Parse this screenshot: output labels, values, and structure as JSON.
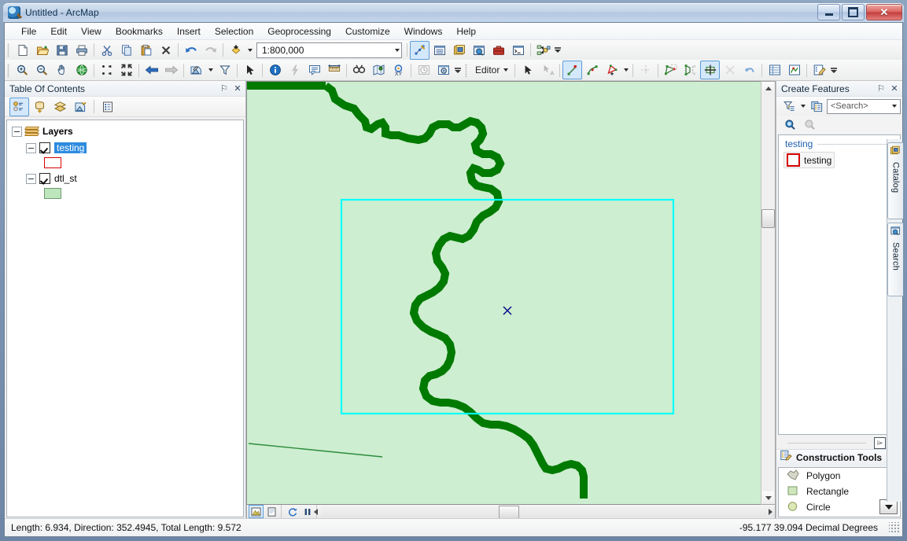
{
  "window": {
    "title": "Untitled - ArcMap",
    "app_icon": "arcmap-globe-icon",
    "minimize_label": "Minimize",
    "maximize_label": "Maximize",
    "close_label": "Close"
  },
  "menubar": {
    "items": [
      {
        "label": "File"
      },
      {
        "label": "Edit"
      },
      {
        "label": "View"
      },
      {
        "label": "Bookmarks"
      },
      {
        "label": "Insert"
      },
      {
        "label": "Selection"
      },
      {
        "label": "Geoprocessing"
      },
      {
        "label": "Customize"
      },
      {
        "label": "Windows"
      },
      {
        "label": "Help"
      }
    ]
  },
  "standard_toolbar": {
    "scale_value": "1:800,000",
    "buttons": [
      {
        "name": "new-map-icon",
        "title": "New Map File"
      },
      {
        "name": "open-icon",
        "title": "Open"
      },
      {
        "name": "save-icon",
        "title": "Save"
      },
      {
        "name": "print-icon",
        "title": "Print"
      },
      {
        "name": "cut-icon",
        "title": "Cut"
      },
      {
        "name": "copy-icon",
        "title": "Copy"
      },
      {
        "name": "paste-icon",
        "title": "Paste"
      },
      {
        "name": "delete-icon",
        "title": "Delete"
      },
      {
        "name": "undo-icon",
        "title": "Undo"
      },
      {
        "name": "redo-icon",
        "title": "Redo"
      },
      {
        "name": "add-data-icon",
        "title": "Add Data"
      },
      {
        "name": "editor-vertices-icon",
        "title": "Editor Toolbar"
      },
      {
        "name": "table-of-contents-icon",
        "title": "Table Of Contents"
      },
      {
        "name": "catalog-window-icon",
        "title": "Catalog"
      },
      {
        "name": "search-window-icon",
        "title": "Search"
      },
      {
        "name": "toolbox-icon",
        "title": "ArcToolbox"
      },
      {
        "name": "python-window-icon",
        "title": "Python Window"
      },
      {
        "name": "model-builder-icon",
        "title": "ModelBuilder"
      }
    ]
  },
  "tools_toolbar": {
    "editor_label": "Editor",
    "buttons": [
      {
        "name": "zoom-in-icon",
        "title": "Zoom In"
      },
      {
        "name": "zoom-out-icon",
        "title": "Zoom Out"
      },
      {
        "name": "pan-icon",
        "title": "Pan"
      },
      {
        "name": "full-extent-icon",
        "title": "Full Extent"
      },
      {
        "name": "fixed-zoom-in-icon",
        "title": "Fixed Zoom In"
      },
      {
        "name": "fixed-zoom-out-icon",
        "title": "Fixed Zoom Out"
      },
      {
        "name": "go-back-extent-icon",
        "title": "Go Back To Previous Extent"
      },
      {
        "name": "go-next-extent-icon",
        "title": "Go To Next Extent"
      },
      {
        "name": "select-features-icon",
        "title": "Select Features"
      },
      {
        "name": "clear-selection-icon",
        "title": "Clear Selected Features"
      },
      {
        "name": "select-elements-icon",
        "title": "Select Elements"
      },
      {
        "name": "identify-icon",
        "title": "Identify"
      },
      {
        "name": "hyperlink-icon",
        "title": "Hyperlink"
      },
      {
        "name": "html-popup-icon",
        "title": "HTML Popup"
      },
      {
        "name": "measure-icon",
        "title": "Measure"
      },
      {
        "name": "find-icon",
        "title": "Find"
      },
      {
        "name": "find-route-icon",
        "title": "Find Route"
      },
      {
        "name": "go-to-xy-icon",
        "title": "Go To XY"
      },
      {
        "name": "time-slider-icon",
        "title": "Time Slider"
      },
      {
        "name": "create-viewer-icon",
        "title": "Create Viewer Window"
      },
      {
        "name": "edit-tool-icon",
        "title": "Edit Tool"
      },
      {
        "name": "edit-annotation-icon",
        "title": "Edit Annotation Tool"
      },
      {
        "name": "straight-segment-icon",
        "title": "Straight Segment"
      },
      {
        "name": "trace-icon",
        "title": "Trace"
      },
      {
        "name": "construct-point-icon",
        "title": "Construct Points"
      },
      {
        "name": "edit-vertices-icon",
        "title": "Edit Vertices"
      },
      {
        "name": "reshape-feature-icon",
        "title": "Reshape Feature Tool"
      },
      {
        "name": "cut-polygons-icon",
        "title": "Cut Polygons Tool"
      },
      {
        "name": "split-tool-icon",
        "title": "Split Tool"
      },
      {
        "name": "rotate-tool-icon",
        "title": "Rotate Tool"
      },
      {
        "name": "attributes-icon",
        "title": "Attributes"
      },
      {
        "name": "sketch-properties-icon",
        "title": "Sketch Properties"
      },
      {
        "name": "create-features-icon",
        "title": "Create Features"
      }
    ]
  },
  "table_of_contents": {
    "caption": "Table Of Contents",
    "pin_glyph": "⚐",
    "close_glyph": "✕",
    "toolbar": [
      {
        "name": "list-by-drawing-order-icon",
        "title": "List By Drawing Order",
        "active": true
      },
      {
        "name": "list-by-source-icon",
        "title": "List By Source",
        "active": false
      },
      {
        "name": "list-by-visibility-icon",
        "title": "List By Visibility",
        "active": false
      },
      {
        "name": "list-by-selection-icon",
        "title": "List By Selection",
        "active": false
      },
      {
        "name": "options-icon",
        "title": "Options",
        "active": false
      }
    ],
    "tree": {
      "root_label": "Layers",
      "layers": [
        {
          "name": "testing",
          "checked": true,
          "selected": true,
          "symbol_fill": "#ffffff",
          "symbol_stroke": "#d60000"
        },
        {
          "name": "dtl_st",
          "checked": true,
          "selected": false,
          "symbol_fill": "#bde6bd",
          "symbol_stroke": "#6f9a6f"
        }
      ]
    }
  },
  "create_features": {
    "caption": "Create Features",
    "pin_glyph": "⚐",
    "close_glyph": "✕",
    "search_placeholder": "<Search>",
    "toolbar": [
      {
        "name": "organize-templates-icon",
        "title": "Organize Templates"
      },
      {
        "name": "create-new-template-icon",
        "title": "Create New Template"
      },
      {
        "name": "search-icon",
        "title": "Search"
      },
      {
        "name": "clear-search-icon",
        "title": "Clear Search"
      }
    ],
    "group_label": "testing",
    "templates": [
      {
        "label": "testing",
        "swatch_fill": "#ffffff",
        "swatch_stroke": "#d60000"
      }
    ],
    "collapse_glyph": "⌲",
    "expand_glyph": "I"
  },
  "construction_tools": {
    "caption": "Construction Tools",
    "icon": "construction-tools-icon",
    "items": [
      {
        "label": "Polygon",
        "icon": "polygon-tool-icon"
      },
      {
        "label": "Rectangle",
        "icon": "rectangle-tool-icon"
      },
      {
        "label": "Circle",
        "icon": "circle-tool-icon"
      }
    ]
  },
  "right_tabs": [
    {
      "label": "Catalog",
      "icon": "catalog-icon"
    },
    {
      "label": "Search",
      "icon": "search-tab-icon"
    }
  ],
  "map": {
    "background_fill": "#cdeed0",
    "boundary_stroke": "#007a00",
    "selection_stroke": "#00ffff",
    "sketch_marker": "x-vertex-marker",
    "sketch_line_stroke": "#2e8b3d",
    "bottom_bar": [
      {
        "name": "data-view-icon",
        "title": "Data View",
        "active": true
      },
      {
        "name": "layout-view-icon",
        "title": "Layout View",
        "active": false
      },
      {
        "name": "refresh-view-icon",
        "title": "Refresh View",
        "active": false
      },
      {
        "name": "pause-drawing-icon",
        "title": "Pause Drawing",
        "active": false
      }
    ]
  },
  "statusbar": {
    "message": "Length: 6.934, Direction: 352.4945, Total Length: 9.572",
    "coordinates": "-95.177  39.094 Decimal Degrees"
  }
}
